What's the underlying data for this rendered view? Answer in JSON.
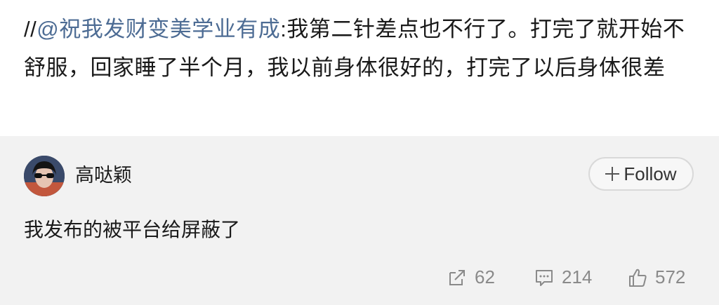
{
  "post": {
    "repost_prefix": "//",
    "mention": "@祝我发财变美学业有成",
    "colon": ":",
    "body": "我第二针差点也不行了。打完了就开始不舒服，回家睡了半个月，我以前身体很好的，打完了以后身体很差"
  },
  "comment": {
    "username": "高哒颖",
    "follow_label": "Follow",
    "text": "我发布的被平台给屏蔽了",
    "actions": {
      "repost_count": "62",
      "comment_count": "214",
      "like_count": "572"
    },
    "icons": {
      "repost": "share-icon",
      "comment": "comment-icon",
      "like": "thumbs-up-icon",
      "follow": "plus-icon"
    }
  }
}
